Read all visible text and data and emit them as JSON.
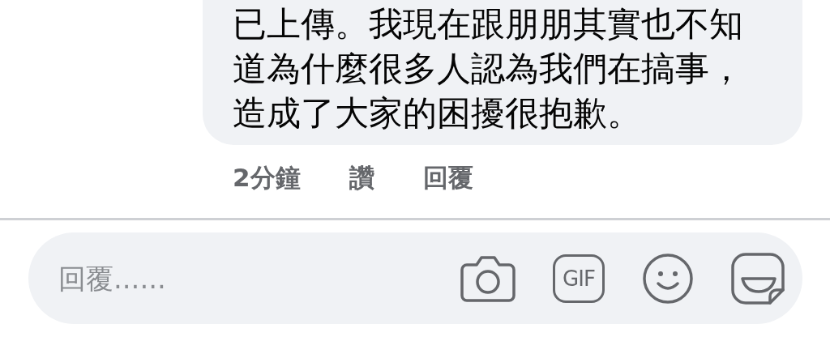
{
  "comment": {
    "text": "已上傳。我現在跟朋朋其實也不知道為什麼很多人認為我們在搞事，造成了大家的困擾很抱歉。",
    "actions": [
      {
        "label": "2分鐘"
      },
      {
        "label": "讚"
      },
      {
        "label": "回覆"
      }
    ]
  },
  "reply_bar": {
    "placeholder": "回覆......",
    "gif_label": "GIF"
  }
}
